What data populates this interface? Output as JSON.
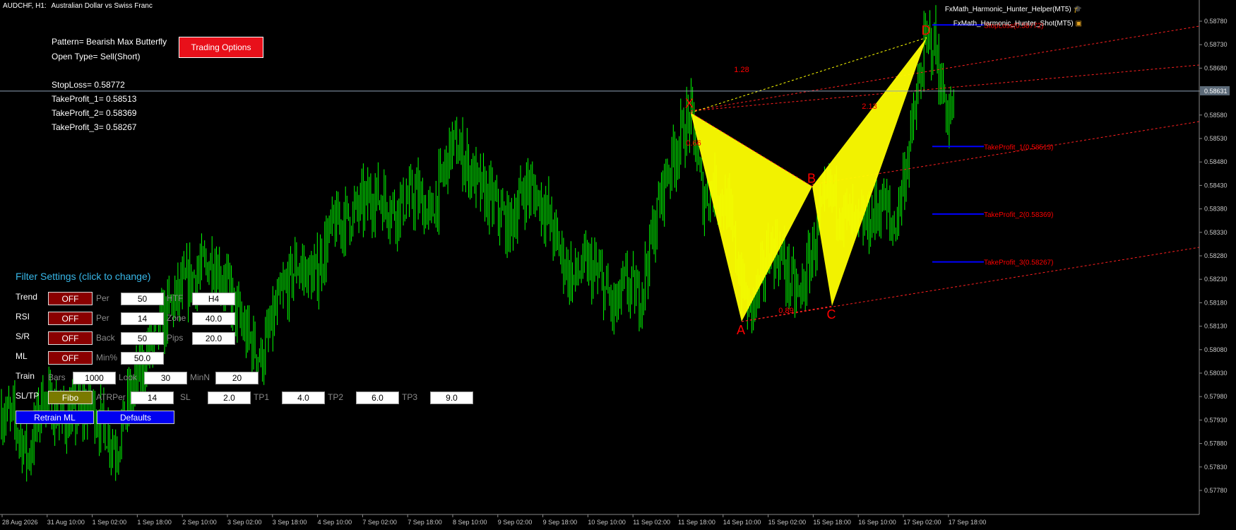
{
  "header": {
    "symbol": "AUDCHF, H1:",
    "description": "Australian Dollar vs Swiss Franc"
  },
  "indicators": [
    {
      "name": "FxMath_Harmonic_Hunter_Helper(MT5)",
      "icon": "graduation-cap-icon"
    },
    {
      "name": "FxMath_Harmonic_Hunter_Shot(MT5)",
      "icon": "note-icon"
    }
  ],
  "info": {
    "pattern": "Pattern= Bearish Max Butterfly",
    "open_type": "Open Type= Sell(Short)",
    "stoploss": "StopLoss= 0.58772",
    "tp1": "TakeProfit_1= 0.58513",
    "tp2": "TakeProfit_2= 0.58369",
    "tp3": "TakeProfit_3= 0.58267",
    "trading_options_label": "Trading Options"
  },
  "filter": {
    "title": "Filter Settings  (click to change)",
    "trend": {
      "label": "Trend",
      "state": "OFF",
      "per_label": "Per",
      "per": "50",
      "htf_label": "HTF",
      "htf": "H4"
    },
    "rsi": {
      "label": "RSI",
      "state": "OFF",
      "per_label": "Per",
      "per": "14",
      "zone_label": "Zone",
      "zone": "40.0"
    },
    "sr": {
      "label": "S/R",
      "state": "OFF",
      "back_label": "Back",
      "back": "50",
      "pips_label": "Pips",
      "pips": "20.0"
    },
    "ml": {
      "label": "ML",
      "state": "OFF",
      "min_label": "Min%",
      "min": "50.0"
    },
    "train": {
      "label": "Train",
      "bars_label": "Bars",
      "bars": "1000",
      "look_label": "Look",
      "look": "30",
      "minn_label": "MinN",
      "minn": "20"
    },
    "sltp": {
      "label": "SL/TP",
      "mode": "Fibo",
      "atr_label": "ATRPer",
      "atr": "14",
      "sl_label": "SL",
      "sl": "2.0",
      "tp1_label": "TP1",
      "tp1": "4.0",
      "tp2_label": "TP2",
      "tp2": "6.0",
      "tp3_label": "TP3",
      "tp3": "9.0"
    },
    "retrain_label": "Retrain ML",
    "defaults_label": "Defaults"
  },
  "pattern_points": {
    "x": "X",
    "a": "A",
    "b": "B",
    "c": "C",
    "d": "D"
  },
  "ratios": {
    "xb": "1.28",
    "bd": "2.13",
    "xa": "0.66",
    "ac": "0.89"
  },
  "levels": {
    "sl": "StopLoss(0.58772)",
    "tp1": "TakeProfit_1(0.58513)",
    "tp2": "TakeProfit_2(0.58369)",
    "tp3": "TakeProfit_3(0.58267)"
  },
  "price_axis": {
    "labels": [
      "0.58780",
      "0.58730",
      "0.58680",
      "0.58631",
      "0.58580",
      "0.58530",
      "0.58480",
      "0.58430",
      "0.58380",
      "0.58330",
      "0.58280",
      "0.58230",
      "0.58180",
      "0.58130",
      "0.58080",
      "0.58030",
      "0.57980",
      "0.57930",
      "0.57880",
      "0.57830",
      "0.57780"
    ],
    "current": "0.58631"
  },
  "time_axis": [
    "28 Aug 2026",
    "31 Aug 10:00",
    "1 Sep 02:00",
    "1 Sep 18:00",
    "2 Sep 10:00",
    "3 Sep 02:00",
    "3 Sep 18:00",
    "4 Sep 10:00",
    "7 Sep 02:00",
    "7 Sep 18:00",
    "8 Sep 10:00",
    "9 Sep 02:00",
    "9 Sep 18:00",
    "10 Sep 10:00",
    "11 Sep 02:00",
    "11 Sep 18:00",
    "14 Sep 10:00",
    "15 Sep 02:00",
    "15 Sep 18:00",
    "16 Sep 10:00",
    "17 Sep 02:00",
    "17 Sep 18:00"
  ],
  "colors": {
    "background": "#000000",
    "candle": "#00ff00",
    "pattern_fill": "#ffff00",
    "level_line": "#0000ff",
    "channel_line": "#ff2020",
    "label_red": "#ff0000",
    "filter_title": "#37b7e8"
  },
  "chart_data": {
    "type": "candlestick",
    "symbol": "AUDCHF",
    "timeframe": "H1",
    "points": [
      {
        "label": "X",
        "price": 0.58585
      },
      {
        "label": "A",
        "price": 0.5814
      },
      {
        "label": "B",
        "price": 0.58428
      },
      {
        "label": "C",
        "price": 0.58173
      },
      {
        "label": "D",
        "price": 0.58745
      }
    ],
    "levels": {
      "stoploss": 0.58772,
      "tp1": 0.58513,
      "tp2": 0.58369,
      "tp3": 0.58267
    },
    "current_price": 0.58631,
    "ylim": [
      0.5775,
      0.588
    ]
  }
}
